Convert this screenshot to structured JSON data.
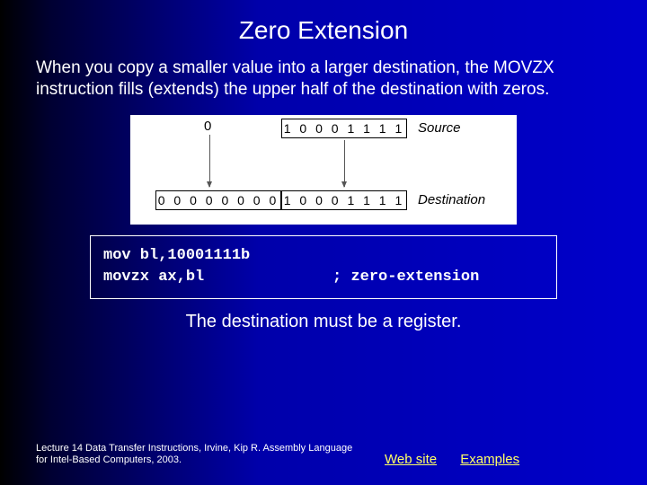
{
  "title": "Zero Extension",
  "body": "When you copy a smaller value into a larger destination, the MOVZX instruction fills (extends) the upper half of the destination with zeros.",
  "diagram": {
    "zero": "0",
    "source_bits": "1 0 0 0 1 1 1 1",
    "source_label": "Source",
    "dest_left_bits": "0 0 0 0 0 0 0 0",
    "dest_right_bits": "1 0 0 0 1 1 1 1",
    "dest_label": "Destination"
  },
  "code": {
    "line1": "mov bl,10001111b",
    "line2_left": "movzx ax,bl",
    "line2_right": "; zero-extension"
  },
  "note": "The destination must be a register.",
  "footer": {
    "cite": "Lecture 14 Data Transfer Instructions, Irvine, Kip R. Assembly Language for Intel-Based Computers, 2003.",
    "link1": "Web site",
    "link2": "Examples"
  }
}
